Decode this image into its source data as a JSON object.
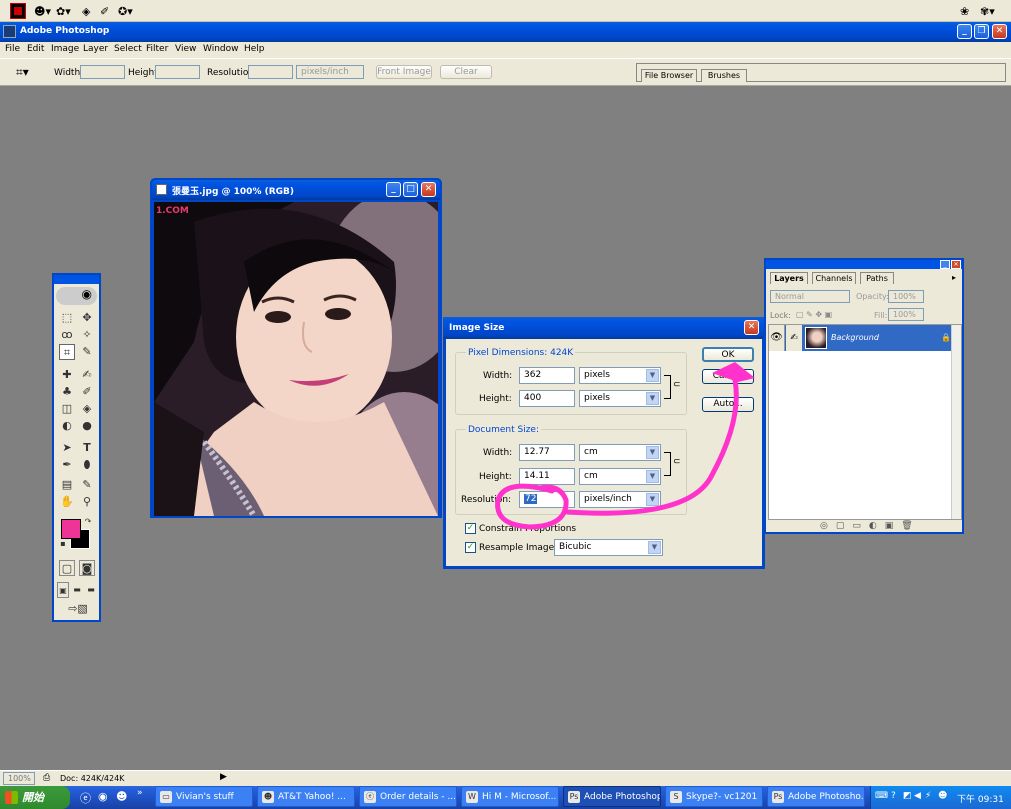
{
  "top_strip": {
    "icons": [
      "app-icon",
      "smiley-icon",
      "tool-icon",
      "gear-icon",
      "arrow-icon"
    ],
    "right_icons": [
      "tray-icon-1",
      "tray-icon-2"
    ]
  },
  "app": {
    "title": "Adobe Photoshop",
    "menu": [
      "File",
      "Edit",
      "Image",
      "Layer",
      "Select",
      "Filter",
      "View",
      "Window",
      "Help"
    ]
  },
  "options_bar": {
    "width_label": "Width:",
    "height_label": "Height:",
    "resolution_label": "Resolution:",
    "unit": "pixels/inch",
    "front_image": "Front Image",
    "clear": "Clear",
    "tabs": [
      "File Browser",
      "Brushes"
    ]
  },
  "doc_window": {
    "title": "張曼玉.jpg @ 100% (RGB)",
    "watermark": "1.COM"
  },
  "dialog": {
    "title": "Image Size",
    "pixel_dimensions": "Pixel Dimensions: 424K",
    "px_width_label": "Width:",
    "px_width": "362",
    "px_width_unit": "pixels",
    "px_height_label": "Height:",
    "px_height": "400",
    "px_height_unit": "pixels",
    "document_size": "Document Size:",
    "doc_width_label": "Width:",
    "doc_width": "12.77",
    "doc_width_unit": "cm",
    "doc_height_label": "Height:",
    "doc_height": "14.11",
    "doc_height_unit": "cm",
    "resolution_label": "Resolution:",
    "resolution": "72",
    "resolution_unit": "pixels/inch",
    "constrain": "Constrain Proportions",
    "resample": "Resample Image:",
    "resample_method": "Bicubic",
    "ok": "OK",
    "cancel": "Cancel",
    "auto": "Auto..."
  },
  "layers_panel": {
    "tabs": [
      "Layers",
      "Channels",
      "Paths"
    ],
    "blend_mode": "Normal",
    "opacity_label": "Opacity:",
    "opacity": "100%",
    "lock_label": "Lock:",
    "fill_label": "Fill:",
    "fill": "100%",
    "layer_name": "Background"
  },
  "status_bar": {
    "zoom": "100%",
    "doc": "Doc: 424K/424K"
  },
  "taskbar": {
    "start": "開始",
    "items": [
      "Vivian's stuff",
      "AT&T Yahoo! ...",
      "Order details - ...",
      "Hi M - Microsof...",
      "Adobe Photoshop",
      "Skype?- vc1201",
      "Adobe Photosho..."
    ],
    "clock": "下午 09:31"
  },
  "colors": {
    "accent": "#ff33cc",
    "title_blue": "#0054e3",
    "foreground": "#ee3399",
    "background": "#000000"
  }
}
